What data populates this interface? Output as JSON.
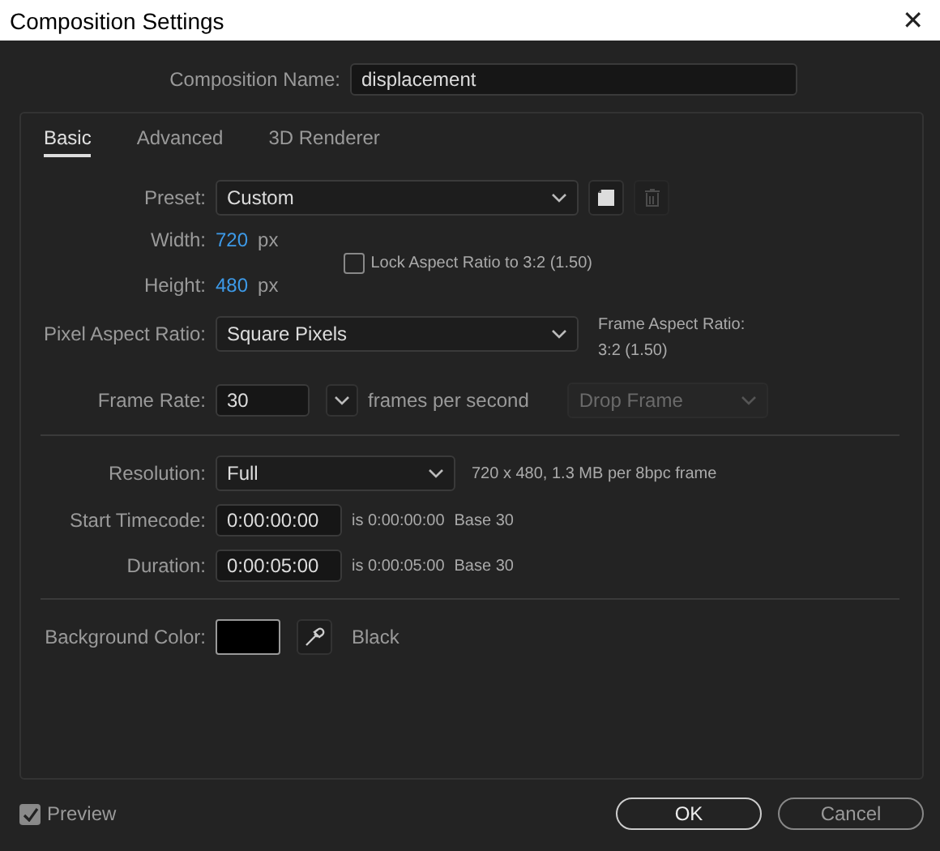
{
  "window": {
    "title": "Composition Settings",
    "close": "✕"
  },
  "composition_name": {
    "label": "Composition Name:",
    "value": "displacement"
  },
  "tabs": [
    {
      "label": "Basic",
      "selected": true
    },
    {
      "label": "Advanced",
      "selected": false
    },
    {
      "label": "3D Renderer",
      "selected": false
    }
  ],
  "preset": {
    "label": "Preset:",
    "value": "Custom",
    "delete_disabled": true
  },
  "width": {
    "label": "Width:",
    "value": "720",
    "unit": "px"
  },
  "height": {
    "label": "Height:",
    "value": "480",
    "unit": "px"
  },
  "lock_aspect": {
    "label": "Lock Aspect Ratio to 3:2 (1.50)",
    "checked": false
  },
  "pixel_aspect_ratio": {
    "label": "Pixel Aspect Ratio:",
    "value": "Square Pixels"
  },
  "frame_aspect_ratio": {
    "label": "Frame Aspect Ratio:",
    "value": "3:2 (1.50)"
  },
  "frame_rate": {
    "label": "Frame Rate:",
    "value": "30",
    "unit": "frames per second"
  },
  "drop_frame": {
    "value": "Drop Frame",
    "disabled": true
  },
  "resolution": {
    "label": "Resolution:",
    "value": "Full",
    "info": "720 x 480, 1.3 MB per 8bpc frame"
  },
  "start_timecode": {
    "label": "Start Timecode:",
    "value": "0:00:00:00",
    "is": "is 0:00:00:00",
    "base": "Base 30"
  },
  "duration": {
    "label": "Duration:",
    "value": "0:00:05:00",
    "is": "is 0:00:05:00",
    "base": "Base 30"
  },
  "background_color": {
    "label": "Background Color:",
    "color": "#000000",
    "name": "Black"
  },
  "preview": {
    "label": "Preview",
    "checked": true
  },
  "buttons": [
    {
      "label": "OK",
      "kind": "primary"
    },
    {
      "label": "Cancel",
      "kind": "secondary"
    }
  ]
}
